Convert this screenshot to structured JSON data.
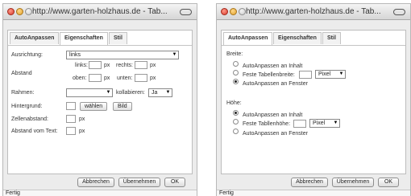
{
  "left_window": {
    "title": "http://www.garten-holzhaus.de - Tab...",
    "tabs": [
      {
        "label": "AutoAnpassen",
        "active": false
      },
      {
        "label": "Eigenschaften",
        "active": true
      },
      {
        "label": "Stil",
        "active": false
      }
    ],
    "fields": {
      "ausrichtung_label": "Ausrichtung:",
      "ausrichtung_value": "links",
      "abstand_label": "Abstand",
      "links": "links:",
      "rechts": "rechts:",
      "oben": "oben:",
      "unten": "unten:",
      "px": "px",
      "rahmen_label": "Rahmen:",
      "rahmen_value": "",
      "kollabieren_label": "kollabieren:",
      "kollabieren_value": "Ja",
      "hintergrund_label": "Hintergrund:",
      "waehlen": "wählen",
      "bild": "Bild",
      "zellenabstand_label": "Zellenabstand:",
      "abstand_text_label": "Abstand vom Text:"
    },
    "buttons": {
      "cancel": "Abbrechen",
      "apply": "Übernehmen",
      "ok": "OK"
    },
    "status": "Fertig"
  },
  "right_window": {
    "title": "http://www.garten-holzhaus.de - Tab...",
    "tabs": [
      {
        "label": "AutoAnpassen",
        "active": true
      },
      {
        "label": "Eigenschaften",
        "active": false
      },
      {
        "label": "Stil",
        "active": false
      }
    ],
    "breite": {
      "heading": "Breite:",
      "opt_inhalt": "AutoAnpassen an Inhalt",
      "opt_fest": "Feste Tabellenbreite:",
      "unit": "Pixel",
      "opt_fenster": "AutoAnpassen an Fenster",
      "selected": "fenster"
    },
    "hoehe": {
      "heading": "Höhe:",
      "opt_inhalt": "AutoAnpassen an Inhalt",
      "opt_fest": "Feste Tabllenhöhe:",
      "unit": "Pixel",
      "opt_fenster": "AutoAnpassen an Fenster",
      "selected": "inhalt"
    },
    "buttons": {
      "cancel": "Abbrechen",
      "apply": "Übernehmen",
      "ok": "OK"
    },
    "status": "Fertig"
  }
}
